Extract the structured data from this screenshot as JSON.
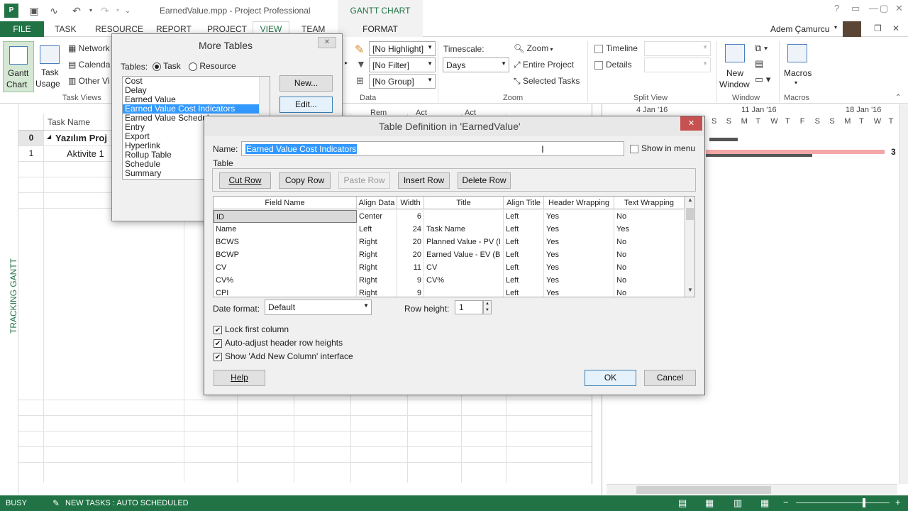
{
  "window": {
    "title": "EarnedValue.mpp - Project Professional",
    "context_tab": "GANTT CHART TOOLS"
  },
  "tabs": [
    "FILE",
    "TASK",
    "RESOURCE",
    "REPORT",
    "PROJECT",
    "VIEW",
    "TEAM",
    "FORMAT"
  ],
  "user": {
    "name": "Adem Çamurcu"
  },
  "ribbon": {
    "task_views": {
      "gantt_label": "Gantt",
      "gantt_label2": "Chart",
      "task_usage": "Task",
      "task_usage2": "Usage",
      "network": "Network",
      "calendar": "Calenda",
      "other": "Other Vi",
      "label": "Task Views"
    },
    "data": {
      "highlight": "[No Highlight]",
      "filter": "[No Filter]",
      "group": "[No Group]",
      "label": "Data"
    },
    "zoom": {
      "timescale_label": "Timescale:",
      "timescale_value": "Days",
      "zoom": "Zoom",
      "entire_project": "Entire Project",
      "selected_tasks": "Selected Tasks",
      "label": "Zoom"
    },
    "split_view": {
      "timeline": "Timeline",
      "details": "Details",
      "label": "Split View"
    },
    "window": {
      "new_window": "New",
      "new_window2": "Window",
      "label": "Window"
    },
    "macros": {
      "macros": "Macros",
      "label": "Macros"
    }
  },
  "gantt": {
    "side_label": "TRACKING GANTT",
    "col_task_name": "Task Name",
    "col_rem": "Rem",
    "col_act": "Act",
    "col_act2": "Act",
    "rows": [
      {
        "id": "0",
        "name": "Yazılım Proj"
      },
      {
        "id": "1",
        "name": "Aktivite 1"
      }
    ],
    "timescale_weeks": [
      "4 Jan '16",
      "11 Jan '16",
      "18 Jan '16"
    ],
    "timescale_days": [
      "S",
      "S",
      "M",
      "T",
      "W",
      "T",
      "F",
      "S",
      "S",
      "M",
      "T",
      "W",
      "T"
    ],
    "bar_label": "3"
  },
  "more_tables": {
    "title": "More Tables",
    "tables_label": "Tables:",
    "radio_task": "Task",
    "radio_resource": "Resource",
    "items": [
      "Cost",
      "Delay",
      "Earned Value",
      "Earned Value Cost Indicators",
      "Earned Value Schedule",
      "Entry",
      "Export",
      "Hyperlink",
      "Rollup Table",
      "Schedule",
      "Summary"
    ],
    "selected": "Earned Value Cost Indicators",
    "new_btn": "New...",
    "edit_btn": "Edit..."
  },
  "table_def": {
    "title": "Table Definition in 'EarnedValue'",
    "name_label": "Name:",
    "name_value": "Earned Value Cost Indicators",
    "show_in_menu": "Show in menu",
    "table_label": "Table",
    "buttons": {
      "cut_row": "Cut Row",
      "copy_row": "Copy Row",
      "paste_row": "Paste Row",
      "insert_row": "Insert Row",
      "delete_row": "Delete Row"
    },
    "columns": [
      "Field Name",
      "Align Data",
      "Width",
      "Title",
      "Align Title",
      "Header Wrapping",
      "Text Wrapping"
    ],
    "rows": [
      [
        "ID",
        "Center",
        "6",
        "",
        "Left",
        "Yes",
        "No"
      ],
      [
        "Name",
        "Left",
        "24",
        "Task Name",
        "Left",
        "Yes",
        "Yes"
      ],
      [
        "BCWS",
        "Right",
        "20",
        "Planned Value - PV (I",
        "Left",
        "Yes",
        "No"
      ],
      [
        "BCWP",
        "Right",
        "20",
        "Earned Value - EV (B",
        "Left",
        "Yes",
        "No"
      ],
      [
        "CV",
        "Right",
        "11",
        "CV",
        "Left",
        "Yes",
        "No"
      ],
      [
        "CV%",
        "Right",
        "9",
        "CV%",
        "Left",
        "Yes",
        "No"
      ],
      [
        "CPI",
        "Right",
        "9",
        "",
        "Left",
        "Yes",
        "No"
      ]
    ],
    "date_format_label": "Date format:",
    "date_format_value": "Default",
    "row_height_label": "Row height:",
    "row_height_value": "1",
    "lock_first_column": "Lock first column",
    "auto_adjust": "Auto-adjust header row heights",
    "show_add_new": "Show 'Add New Column' interface",
    "help_btn": "Help",
    "ok_btn": "OK",
    "cancel_btn": "Cancel"
  },
  "status": {
    "busy": "BUSY",
    "new_tasks": "NEW TASKS : AUTO SCHEDULED"
  }
}
